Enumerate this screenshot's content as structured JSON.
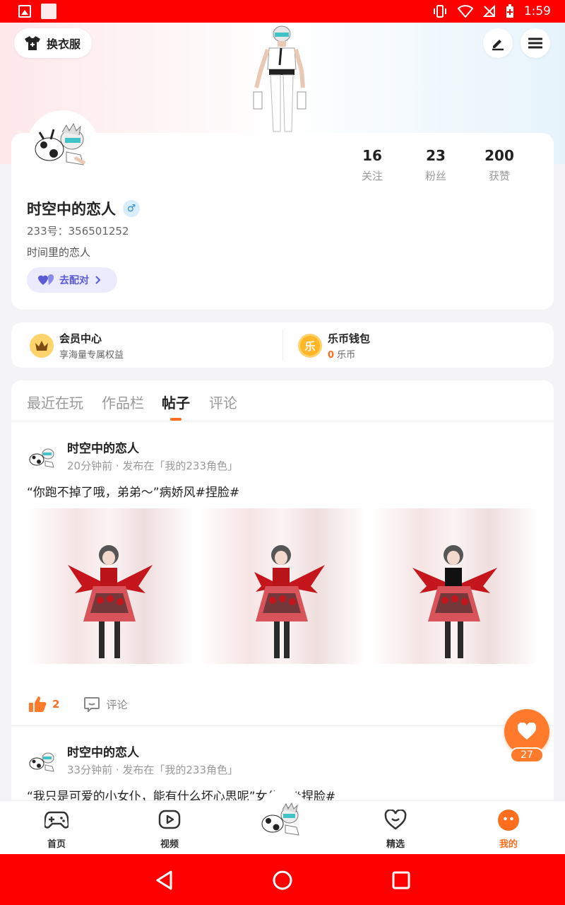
{
  "status_bar": {
    "time": "1:59"
  },
  "header": {
    "outfit_label": "换衣服"
  },
  "profile": {
    "name": "时空中的恋人",
    "gender_symbol": "♂",
    "id_text": "233号：356501252",
    "bio": "时间里的恋人",
    "match_label": "去配对",
    "stats": [
      {
        "value": "16",
        "label": "关注"
      },
      {
        "value": "23",
        "label": "粉丝"
      },
      {
        "value": "200",
        "label": "获赞"
      }
    ]
  },
  "member": {
    "vip_title": "会员中心",
    "vip_sub": "享海量专属权益",
    "wallet_title": "乐币钱包",
    "wallet_amount": "0",
    "wallet_unit": "乐币",
    "wallet_icon_char": "乐"
  },
  "tabs": [
    {
      "label": "最近在玩"
    },
    {
      "label": "作品栏"
    },
    {
      "label": "帖子"
    },
    {
      "label": "评论"
    }
  ],
  "active_tab": "帖子",
  "posts": [
    {
      "author": "时空中的恋人",
      "meta": "20分钟前 · 发布在「我的233角色」",
      "text": "“你跑不掉了哦，弟弟～”病娇风#捏脸#",
      "likes": "2",
      "comment_label": "评论"
    },
    {
      "author": "时空中的恋人",
      "meta": "33分钟前 · 发布在「我的233角色」",
      "text": "“我只是可爱的小女仆，能有什么坏心思呢”女仆风#捏脸#"
    }
  ],
  "fab": {
    "count": "27"
  },
  "bottom_nav": [
    {
      "label": "首页",
      "icon": "gamepad-icon"
    },
    {
      "label": "视频",
      "icon": "video-icon"
    },
    {
      "label": "精选",
      "icon": "featured-heart-icon"
    },
    {
      "label": "我的",
      "icon": "profile-face-icon"
    }
  ],
  "colors": {
    "accent": "#ff6d1f",
    "status_bar": "#ff0000"
  }
}
